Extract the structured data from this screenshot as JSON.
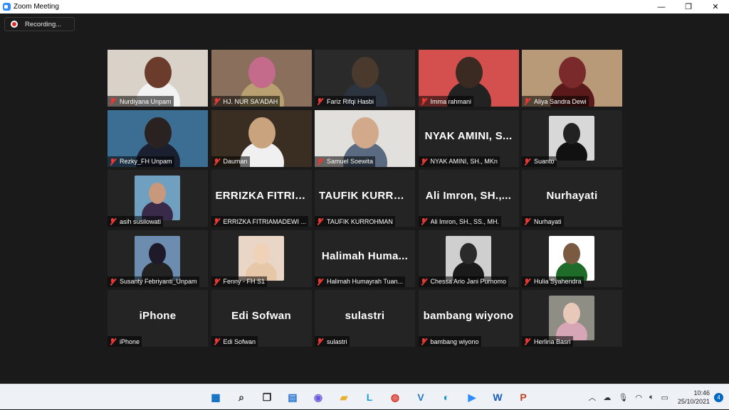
{
  "window": {
    "title": "Zoom Meeting",
    "minimize": "—",
    "maximize": "❐",
    "close": "✕"
  },
  "recording": {
    "label": "Recording..."
  },
  "participants": [
    {
      "name": "Nurdiyana Unpam",
      "kind": "video",
      "bg": "#d9d2c8",
      "face": "#6b3b2b",
      "cloth": "#f2f2f2"
    },
    {
      "name": "HJ. NUR SA'ADAH",
      "kind": "video",
      "bg": "#8a6f5c",
      "face": "#c46a8a",
      "cloth": "#b8a070"
    },
    {
      "name": "Fariz Rifqi Hasbi",
      "kind": "video",
      "bg": "#2a2a2a",
      "face": "#4a3a2e",
      "cloth": "#2c3440"
    },
    {
      "name": "Imma rahmani",
      "kind": "video",
      "bg": "#d4504e",
      "face": "#3a2a22",
      "cloth": "#222"
    },
    {
      "name": "Aliya Sandra Dewi",
      "kind": "video",
      "bg": "#b89a78",
      "face": "#7a2a2a",
      "cloth": "#5a1a1a"
    },
    {
      "name": "Rezky_FH Unpam",
      "kind": "video",
      "bg": "#3c6e93",
      "face": "#2a2220",
      "cloth": "#1a2030"
    },
    {
      "name": "Dauman",
      "kind": "video",
      "bg": "#3a2e22",
      "face": "#c9a27e",
      "cloth": "#f0f0f0"
    },
    {
      "name": "Samuel Soewita",
      "kind": "video",
      "bg": "#e2e0dc",
      "face": "#d2a98a",
      "cloth": "#5a6a80"
    },
    {
      "name": "NYAK AMINI, SH., MKn",
      "kind": "name",
      "big": "NYAK AMINI, S..."
    },
    {
      "name": "Suanto",
      "kind": "thumb",
      "bg": "#d8d8d8",
      "face": "#222",
      "cloth": "#111"
    },
    {
      "name": "asih susilowati",
      "kind": "thumb",
      "bg": "#6fa0c0",
      "face": "#c7987c",
      "cloth": "#3a2a4a"
    },
    {
      "name": "ERRIZKA FITRIAMADEWI ...",
      "kind": "name",
      "big": "ERRIZKA FITRIA..."
    },
    {
      "name": "TAUFIK KURROHMAN",
      "kind": "name",
      "big": "TAUFIK KURRO..."
    },
    {
      "name": "Ali Imron, SH., SS., MH.",
      "kind": "name",
      "big": "Ali Imron, SH.,..."
    },
    {
      "name": "Nurhayati",
      "kind": "name",
      "big": "Nurhayati"
    },
    {
      "name": "Susanty Febriyanti_Unpam",
      "kind": "thumb",
      "bg": "#6d8db0",
      "face": "#1e1a2a",
      "cloth": "#222"
    },
    {
      "name": "Fenny - FH S1",
      "kind": "thumb",
      "bg": "#e9d6c6",
      "face": "#efd2b8",
      "cloth": "#e6c8a8"
    },
    {
      "name": "Halimah Humayrah Tuan...",
      "kind": "name",
      "big": "Halimah Huma..."
    },
    {
      "name": "Chessa Ario Jani Purnomo",
      "kind": "thumb",
      "bg": "#cfcfcf",
      "face": "#2a2a2a",
      "cloth": "#1a1a1a"
    },
    {
      "name": "Hulia Syahendra",
      "kind": "thumb",
      "bg": "#ffffff",
      "face": "#7a5a40",
      "cloth": "#1f6b2a"
    },
    {
      "name": "iPhone",
      "kind": "name",
      "big": "iPhone"
    },
    {
      "name": "Edi Sofwan",
      "kind": "name",
      "big": "Edi Sofwan"
    },
    {
      "name": "sulastri",
      "kind": "name",
      "big": "sulastri"
    },
    {
      "name": "bambang wiyono",
      "kind": "name",
      "big": "bambang wiyono"
    },
    {
      "name": "Herlina Basri",
      "kind": "thumb",
      "bg": "#8e8e84",
      "face": "#e8c8b8",
      "cloth": "#d6a6b6"
    }
  ],
  "taskbar": {
    "apps": [
      {
        "name": "start-icon",
        "glyph": "▦",
        "color": "#0067c0"
      },
      {
        "name": "search-icon",
        "glyph": "⌕",
        "color": "#222"
      },
      {
        "name": "task-view-icon",
        "glyph": "❐",
        "color": "#222"
      },
      {
        "name": "widgets-icon",
        "glyph": "▤",
        "color": "#1f6fd0"
      },
      {
        "name": "chat-icon",
        "glyph": "◉",
        "color": "#6b5ae0"
      },
      {
        "name": "file-explorer-icon",
        "glyph": "▰",
        "color": "#e8b030"
      },
      {
        "name": "app-l-icon",
        "glyph": "L",
        "color": "#1aa0d8"
      },
      {
        "name": "chrome-icon",
        "glyph": "◍",
        "color": "#d93025"
      },
      {
        "name": "vs-app-icon",
        "glyph": "V",
        "color": "#2b79c2"
      },
      {
        "name": "edge-icon",
        "glyph": "◐",
        "color": "#0c8bd0"
      },
      {
        "name": "zoom-icon",
        "glyph": "▶",
        "color": "#2d8cff"
      },
      {
        "name": "word-icon",
        "glyph": "W",
        "color": "#185abd"
      },
      {
        "name": "powerpoint-icon",
        "glyph": "P",
        "color": "#c43e1c"
      }
    ],
    "time": "10:46",
    "date": "25/10/2021",
    "notifications": "4"
  }
}
